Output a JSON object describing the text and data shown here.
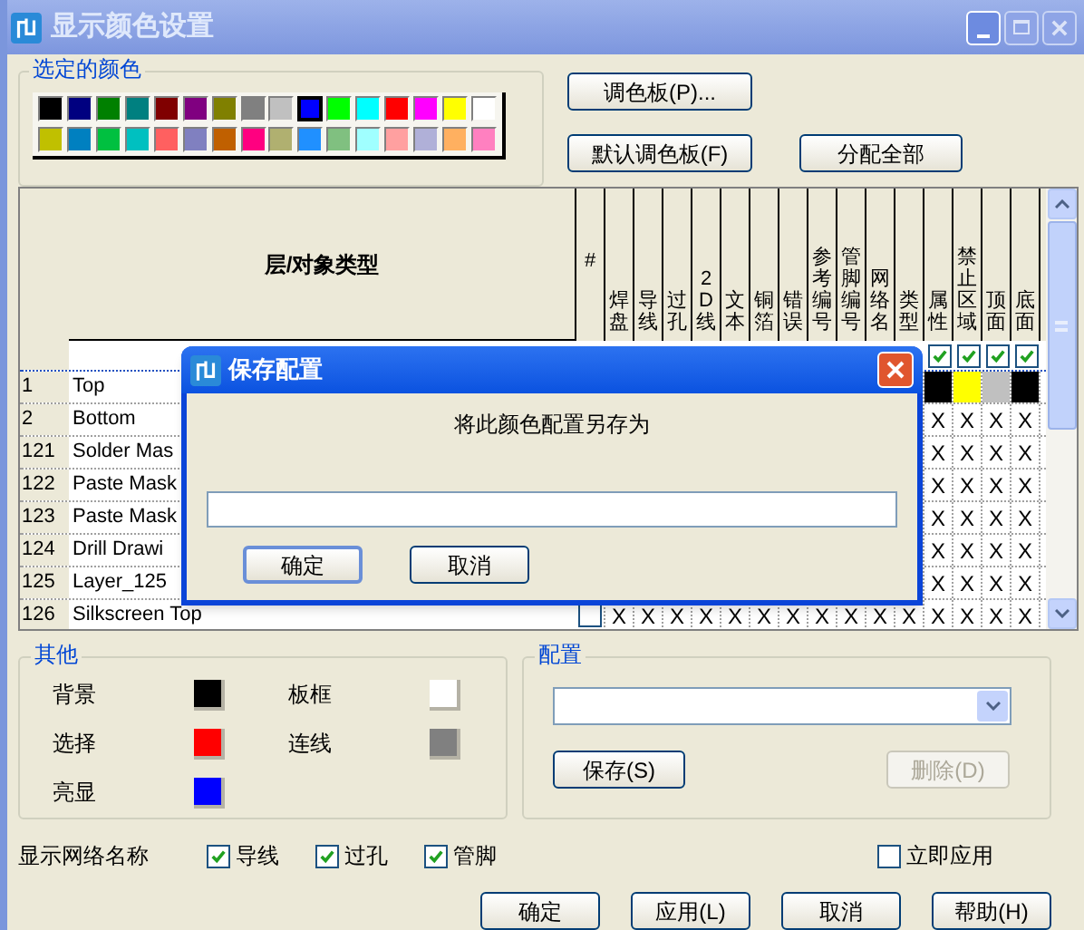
{
  "window": {
    "title": "显示颜色设置"
  },
  "selected_colors": {
    "label": "选定的颜色",
    "swatches": [
      {
        "color": "#000000",
        "selected": false
      },
      {
        "color": "#000080",
        "selected": false
      },
      {
        "color": "#008000",
        "selected": false
      },
      {
        "color": "#008080",
        "selected": false
      },
      {
        "color": "#800000",
        "selected": false
      },
      {
        "color": "#800080",
        "selected": false
      },
      {
        "color": "#808000",
        "selected": false
      },
      {
        "color": "#808080",
        "selected": false
      },
      {
        "color": "#c0c0c0",
        "selected": false
      },
      {
        "color": "#0000ff",
        "selected": true
      },
      {
        "color": "#00ff00",
        "selected": false
      },
      {
        "color": "#00ffff",
        "selected": false
      },
      {
        "color": "#ff0000",
        "selected": false
      },
      {
        "color": "#ff00ff",
        "selected": false
      },
      {
        "color": "#ffff00",
        "selected": false
      },
      {
        "color": "#ffffff",
        "selected": false
      },
      {
        "color": "#c0c000",
        "selected": false
      },
      {
        "color": "#0080c0",
        "selected": false
      },
      {
        "color": "#00c040",
        "selected": false
      },
      {
        "color": "#00c0c0",
        "selected": false
      },
      {
        "color": "#ff6060",
        "selected": false
      },
      {
        "color": "#8080c0",
        "selected": false
      },
      {
        "color": "#c06000",
        "selected": false
      },
      {
        "color": "#ff0080",
        "selected": false
      },
      {
        "color": "#b0b070",
        "selected": false
      },
      {
        "color": "#2090ff",
        "selected": false
      },
      {
        "color": "#80c080",
        "selected": false
      },
      {
        "color": "#a0ffff",
        "selected": false
      },
      {
        "color": "#ffa0a0",
        "selected": false
      },
      {
        "color": "#b0b0d8",
        "selected": false
      },
      {
        "color": "#ffb060",
        "selected": false
      },
      {
        "color": "#ff80c0",
        "selected": false
      }
    ]
  },
  "palette_button": "调色板(P)...",
  "default_palette_button": "默认调色板(F)",
  "assign_all_button": "分配全部",
  "table": {
    "header": "层/对象类型",
    "columns": [
      "#",
      "焊盘",
      "导线",
      "过孔",
      "2D 线",
      "文本",
      "铜箔",
      "错误",
      "参考编号",
      "管脚编号",
      "网络名",
      "类型",
      "属性",
      "禁止区域",
      "顶面",
      "底面"
    ],
    "enable_checks": [
      {
        "checked": true
      },
      {
        "checked": true
      },
      {
        "checked": true
      },
      {
        "checked": true
      }
    ],
    "rows": [
      {
        "number": "1",
        "name": "Top",
        "cells": [
          {
            "kind": "color",
            "color": "#000000"
          },
          {
            "kind": "color",
            "color": "#ffff00"
          },
          {
            "kind": "color",
            "color": "#c0c0c0"
          },
          {
            "kind": "color",
            "color": "#000000"
          }
        ]
      },
      {
        "number": "2",
        "name": "Bottom",
        "cells": [
          {
            "kind": "text",
            "text": "X"
          },
          {
            "kind": "text",
            "text": "X"
          },
          {
            "kind": "text",
            "text": "X"
          },
          {
            "kind": "text",
            "text": "X"
          }
        ]
      },
      {
        "number": "121",
        "name": "Solder Mas",
        "cells": [
          {
            "kind": "text",
            "text": "X"
          },
          {
            "kind": "text",
            "text": "X"
          },
          {
            "kind": "text",
            "text": "X"
          },
          {
            "kind": "text",
            "text": "X"
          }
        ]
      },
      {
        "number": "122",
        "name": "Paste Mask",
        "cells": [
          {
            "kind": "text",
            "text": "X"
          },
          {
            "kind": "text",
            "text": "X"
          },
          {
            "kind": "text",
            "text": "X"
          },
          {
            "kind": "text",
            "text": "X"
          }
        ]
      },
      {
        "number": "123",
        "name": "Paste Mask",
        "cells": [
          {
            "kind": "text",
            "text": "X"
          },
          {
            "kind": "text",
            "text": "X"
          },
          {
            "kind": "text",
            "text": "X"
          },
          {
            "kind": "text",
            "text": "X"
          }
        ]
      },
      {
        "number": "124",
        "name": "Drill Drawi",
        "cells": [
          {
            "kind": "text",
            "text": "X"
          },
          {
            "kind": "text",
            "text": "X"
          },
          {
            "kind": "text",
            "text": "X"
          },
          {
            "kind": "text",
            "text": "X"
          }
        ]
      },
      {
        "number": "125",
        "name": "Layer_125",
        "cells": [
          {
            "kind": "text",
            "text": "X"
          },
          {
            "kind": "text",
            "text": "X"
          },
          {
            "kind": "text",
            "text": "X"
          },
          {
            "kind": "text",
            "text": "X"
          }
        ]
      },
      {
        "number": "126",
        "name": "Silkscreen Top",
        "cells": [
          {
            "kind": "checkbox",
            "checked": false
          },
          {
            "kind": "text",
            "text": "X"
          },
          {
            "kind": "text",
            "text": "X"
          },
          {
            "kind": "text",
            "text": "X"
          },
          {
            "kind": "text",
            "text": "X"
          },
          {
            "kind": "text",
            "text": "X"
          },
          {
            "kind": "text",
            "text": "X"
          },
          {
            "kind": "text",
            "text": "X"
          },
          {
            "kind": "text",
            "text": "X"
          },
          {
            "kind": "text",
            "text": "X"
          },
          {
            "kind": "text",
            "text": "X"
          },
          {
            "kind": "text",
            "text": "X"
          },
          {
            "kind": "text",
            "text": "X"
          },
          {
            "kind": "text",
            "text": "X"
          },
          {
            "kind": "text",
            "text": "X"
          },
          {
            "kind": "text",
            "text": "X"
          }
        ]
      }
    ]
  },
  "other": {
    "label": "其他",
    "items": [
      {
        "label": "背景",
        "color": "#000000"
      },
      {
        "label": "板框",
        "color": "#ffffff"
      },
      {
        "label": "选择",
        "color": "#ff0000"
      },
      {
        "label": "连线",
        "color": "#808080"
      },
      {
        "label": "亮显",
        "color": "#0000ff"
      }
    ]
  },
  "config": {
    "label": "配置",
    "save_button": {
      "label": "保存(S)",
      "disabled": false
    },
    "delete_button": {
      "label": "删除(D)",
      "disabled": true
    }
  },
  "net_names": {
    "label": "显示网络名称",
    "options": [
      {
        "label": "导线",
        "checked": true
      },
      {
        "label": "过孔",
        "checked": true
      },
      {
        "label": "管脚",
        "checked": true
      }
    ]
  },
  "apply_now": {
    "label": "立即应用",
    "checked": false
  },
  "footer_buttons": [
    "确定",
    "应用(L)",
    "取消",
    "帮助(H)"
  ],
  "dialog": {
    "title": "保存配置",
    "message": "将此颜色配置另存为",
    "buttons": [
      {
        "label": "确定",
        "selected": true
      },
      {
        "label": "取消",
        "selected": false
      }
    ]
  }
}
